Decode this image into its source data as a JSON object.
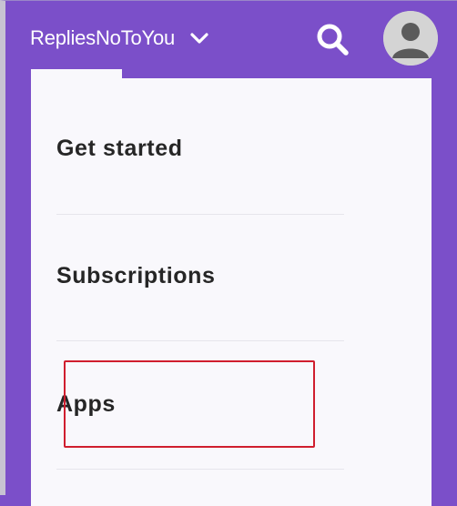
{
  "header": {
    "account_name": "RepliesNoToYou",
    "icons": {
      "chevron": "chevron-down-icon",
      "search": "search-icon",
      "avatar": "user-avatar-icon"
    }
  },
  "menu": {
    "items": [
      {
        "label": "Get started"
      },
      {
        "label": "Subscriptions"
      },
      {
        "label": "Apps"
      }
    ]
  },
  "colors": {
    "header_bg": "#7b4fc9",
    "menu_bg": "#f9f8fc",
    "highlight": "#d01e2e",
    "text": "#262626"
  }
}
